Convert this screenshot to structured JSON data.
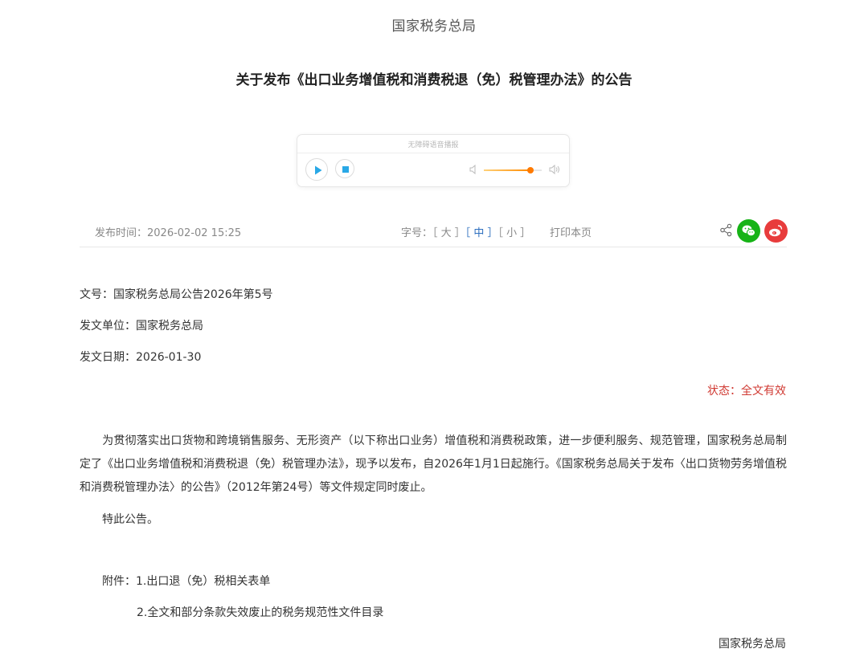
{
  "site": {
    "name": "国家税务总局"
  },
  "article": {
    "title": "关于发布《出口业务增值税和消费税退（免）税管理办法》的公告"
  },
  "player": {
    "label": "无障碍语音播报",
    "volume_percent": 80
  },
  "meta": {
    "publish_time": "发布时间：2026-02-02 15:25",
    "font_size_prefix": "字号：",
    "font_size_large": "［ 大 ］",
    "font_size_medium": "［ 中 ］",
    "font_size_small": "［ 小 ］",
    "print_label": "打印本页"
  },
  "info": {
    "doc_number": "文号：国家税务总局公告2026年第5号",
    "issuer": "发文单位：国家税务总局",
    "issue_date": "发文日期：2026-01-30",
    "status": "状态：全文有效"
  },
  "body": {
    "paragraph": "为贯彻落实出口货物和跨境销售服务、无形资产（以下称出口业务）增值税和消费税政策，进一步便利服务、规范管理，国家税务总局制定了《出口业务增值税和消费税退（免）税管理办法》，现予以发布，自2026年1月1日起施行。《国家税务总局关于发布〈出口货物劳务增值税和消费税管理办法〉的公告》（2012年第24号）等文件规定同时废止。",
    "closing": "特此公告。",
    "attachment_1": "附件：1.出口退（免）税相关表单",
    "attachment_2": "2.全文和部分条款失效废止的税务规范性文件目录",
    "signature": "国家税务总局"
  },
  "colors": {
    "status": "#d03a33",
    "accent": "#2d6fbf",
    "wechat": "#16b316",
    "weibo": "#e83c3c",
    "player_accent": "#29a8e6"
  },
  "icons": {
    "play": "play-icon",
    "stop": "stop-icon",
    "volume_low": "volume-low-icon",
    "volume_high": "volume-high-icon",
    "share": "share-icon",
    "wechat": "wechat-icon",
    "weibo": "weibo-icon"
  }
}
